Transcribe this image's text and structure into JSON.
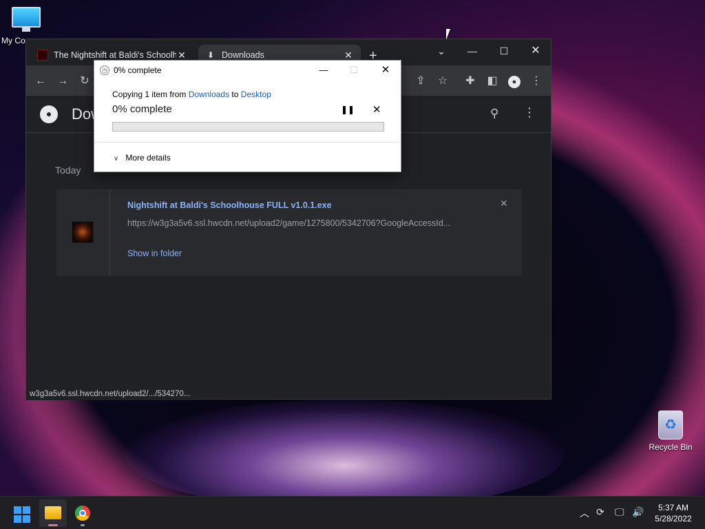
{
  "desktop": {
    "this_pc_label": "My Co",
    "recycle_bin_label": "Recycle Bin"
  },
  "browser": {
    "tabs": [
      {
        "title": "The Nightshift at Baldi's Schoolhouse",
        "favicon": "game-icon",
        "active": false
      },
      {
        "title": "Downloads",
        "favicon": "download-icon",
        "active": true
      }
    ],
    "new_tab_symbol": "+",
    "page_title": "Downloads",
    "date_heading": "Today",
    "download": {
      "file_name": "Nightshift at Baldi's Schoolhouse FULL v1.0.1.exe",
      "url": "https://w3g3a5v6.ssl.hwcdn.net/upload2/game/1275800/5342706?GoogleAccessId...",
      "show_in_folder": "Show in folder"
    },
    "status_bar": "w3g3a5v6.ssl.hwcdn.net/upload2/.../534270..."
  },
  "copy_dialog": {
    "title": "0% complete",
    "copying_prefix": "Copying 1 item from ",
    "source": "Downloads",
    "to_word": " to ",
    "destination": "Desktop",
    "percent_text": "0% complete",
    "progress_percent": 0,
    "more_details": "More details"
  },
  "taskbar": {
    "time": "5:37 AM",
    "date": "5/28/2022"
  },
  "colors": {
    "chrome_bg": "#202124",
    "chrome_toolbar": "#35363a",
    "link_blue": "#8ab4f8",
    "dialog_link": "#1a5fb4"
  }
}
